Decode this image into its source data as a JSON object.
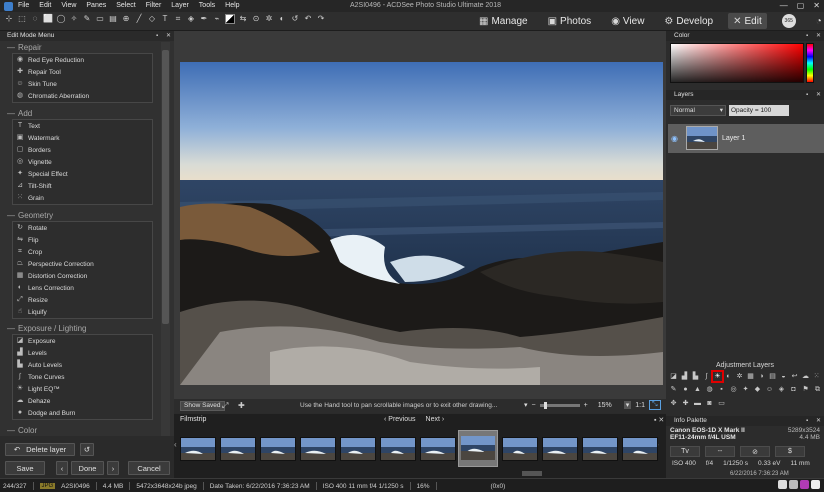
{
  "window": {
    "title": "A2SI0496 - ACDSee Photo Studio Ultimate 2018",
    "menu": [
      "File",
      "Edit",
      "View",
      "Panes",
      "Select",
      "Filter",
      "Layer",
      "Tools",
      "Help"
    ],
    "controls": [
      "—",
      "▢",
      "✕"
    ]
  },
  "modes": [
    {
      "label": "Manage",
      "icon": "grid-icon"
    },
    {
      "label": "Photos",
      "icon": "photos-icon"
    },
    {
      "label": "View",
      "icon": "eye-icon"
    },
    {
      "label": "Develop",
      "icon": "develop-icon"
    },
    {
      "label": "Edit",
      "icon": "edit-icon",
      "active": true
    }
  ],
  "mode_extras": {
    "badge": "365"
  },
  "left_panel": {
    "title": "Edit Mode Menu",
    "sections": [
      {
        "title": "Repair",
        "items": [
          "Red Eye Reduction",
          "Repair Tool",
          "Skin Tune",
          "Chromatic Aberration"
        ]
      },
      {
        "title": "Add",
        "items": [
          "Text",
          "Watermark",
          "Borders",
          "Vignette",
          "Special Effect",
          "Tilt-Shift",
          "Grain"
        ]
      },
      {
        "title": "Geometry",
        "items": [
          "Rotate",
          "Flip",
          "Crop",
          "Perspective Correction",
          "Distortion Correction",
          "Lens Correction",
          "Resize",
          "Liquify"
        ]
      },
      {
        "title": "Exposure / Lighting",
        "items": [
          "Exposure",
          "Levels",
          "Auto Levels",
          "Tone Curves",
          "Light EQ™",
          "Dehaze",
          "Dodge and Burn"
        ]
      },
      {
        "title": "Color",
        "items": []
      }
    ],
    "delete_layer": "Delete layer",
    "save": "Save",
    "done": "Done",
    "cancel": "Cancel"
  },
  "viewer": {
    "show_saved": "Show Saved",
    "hint": "Use the Hand tool to pan scrollable images or to exit other drawing...",
    "zoom": "15%",
    "ratio": "1:1"
  },
  "filmstrip": {
    "title": "Filmstrip",
    "previous": "Previous",
    "next": "Next",
    "thumb_count": 12,
    "selected_index": 7
  },
  "right_panel": {
    "color_title": "Color",
    "layers_title": "Layers",
    "blend_mode": "Normal",
    "opacity": "Opacity = 100",
    "layer_name": "Layer 1",
    "adjustment_title": "Adjustment Layers",
    "info_title": "Info Palette",
    "camera": "Canon EOS-1D X Mark II",
    "lens": "EF11-24mm f/4L USM",
    "dimensions": "5289x3524",
    "filesize": "4.4 MB",
    "exif_modes": [
      "Tv",
      "--",
      "⊘",
      "$"
    ],
    "exif_values": [
      "ISO 400",
      "f/4",
      "1/1250 s",
      "0.33 eV",
      "11 mm"
    ],
    "date": "6/22/2016 7:36:23 AM"
  },
  "statusbar": {
    "count": "244/327",
    "type": "JPG",
    "filename": "A2SI0496",
    "size": "4.4 MB",
    "file": "5472x3648x24b jpeg",
    "taken": "Date Taken: 6/22/2016 7:36:23 AM",
    "exif": "ISO 400   11 mm   f/4   1/1250 s",
    "zoom": "16%",
    "coords": "(0x0)"
  },
  "colors": {
    "accent_selection": "#5e5e5e",
    "highlight_box": "#e00000",
    "sky_top": "#3f6fb8",
    "sky_horizon": "#e8e0cf"
  }
}
